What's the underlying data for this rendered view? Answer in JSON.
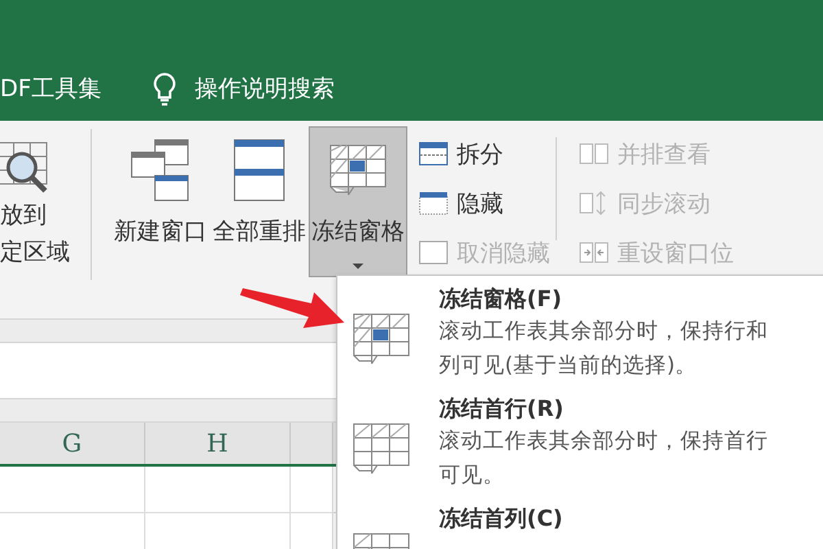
{
  "title_bar": {
    "tabs": [
      {
        "label": "DF工具集"
      },
      {
        "label": "操作说明搜索",
        "kind": "search"
      }
    ]
  },
  "ribbon": {
    "partial_button": {
      "lines": [
        "放到",
        "定区域"
      ]
    },
    "large_buttons": [
      {
        "label": "新建窗口",
        "kind": "new-window",
        "selected": false
      },
      {
        "label": "全部重排",
        "kind": "arrange",
        "selected": false
      },
      {
        "label": "冻结窗格",
        "kind": "freeze",
        "selected": true,
        "dropdown": true
      }
    ],
    "small_groups": [
      [
        {
          "label": "拆分",
          "kind": "split",
          "disabled": false
        },
        {
          "label": "隐藏",
          "kind": "hide",
          "disabled": false
        },
        {
          "label": "取消隐藏",
          "kind": "unhide",
          "disabled": true
        }
      ],
      [
        {
          "label": "并排查看",
          "kind": "side",
          "disabled": true
        },
        {
          "label": "同步滚动",
          "kind": "sync",
          "disabled": true
        },
        {
          "label": "重设窗口位",
          "kind": "reset",
          "disabled": true
        }
      ]
    ]
  },
  "columns": [
    {
      "label": "G"
    },
    {
      "label": "H"
    }
  ],
  "menu": {
    "items": [
      {
        "title": "冻结窗格(F)",
        "description": "滚动工作表其余部分时，保持行和列可见(基于当前的选择)。",
        "kind": "panes"
      },
      {
        "title": "冻结首行(R)",
        "description": "滚动工作表其余部分时，保持首行可见。",
        "kind": "row"
      },
      {
        "title": "冻结首列(C)",
        "kind": "col"
      }
    ]
  }
}
